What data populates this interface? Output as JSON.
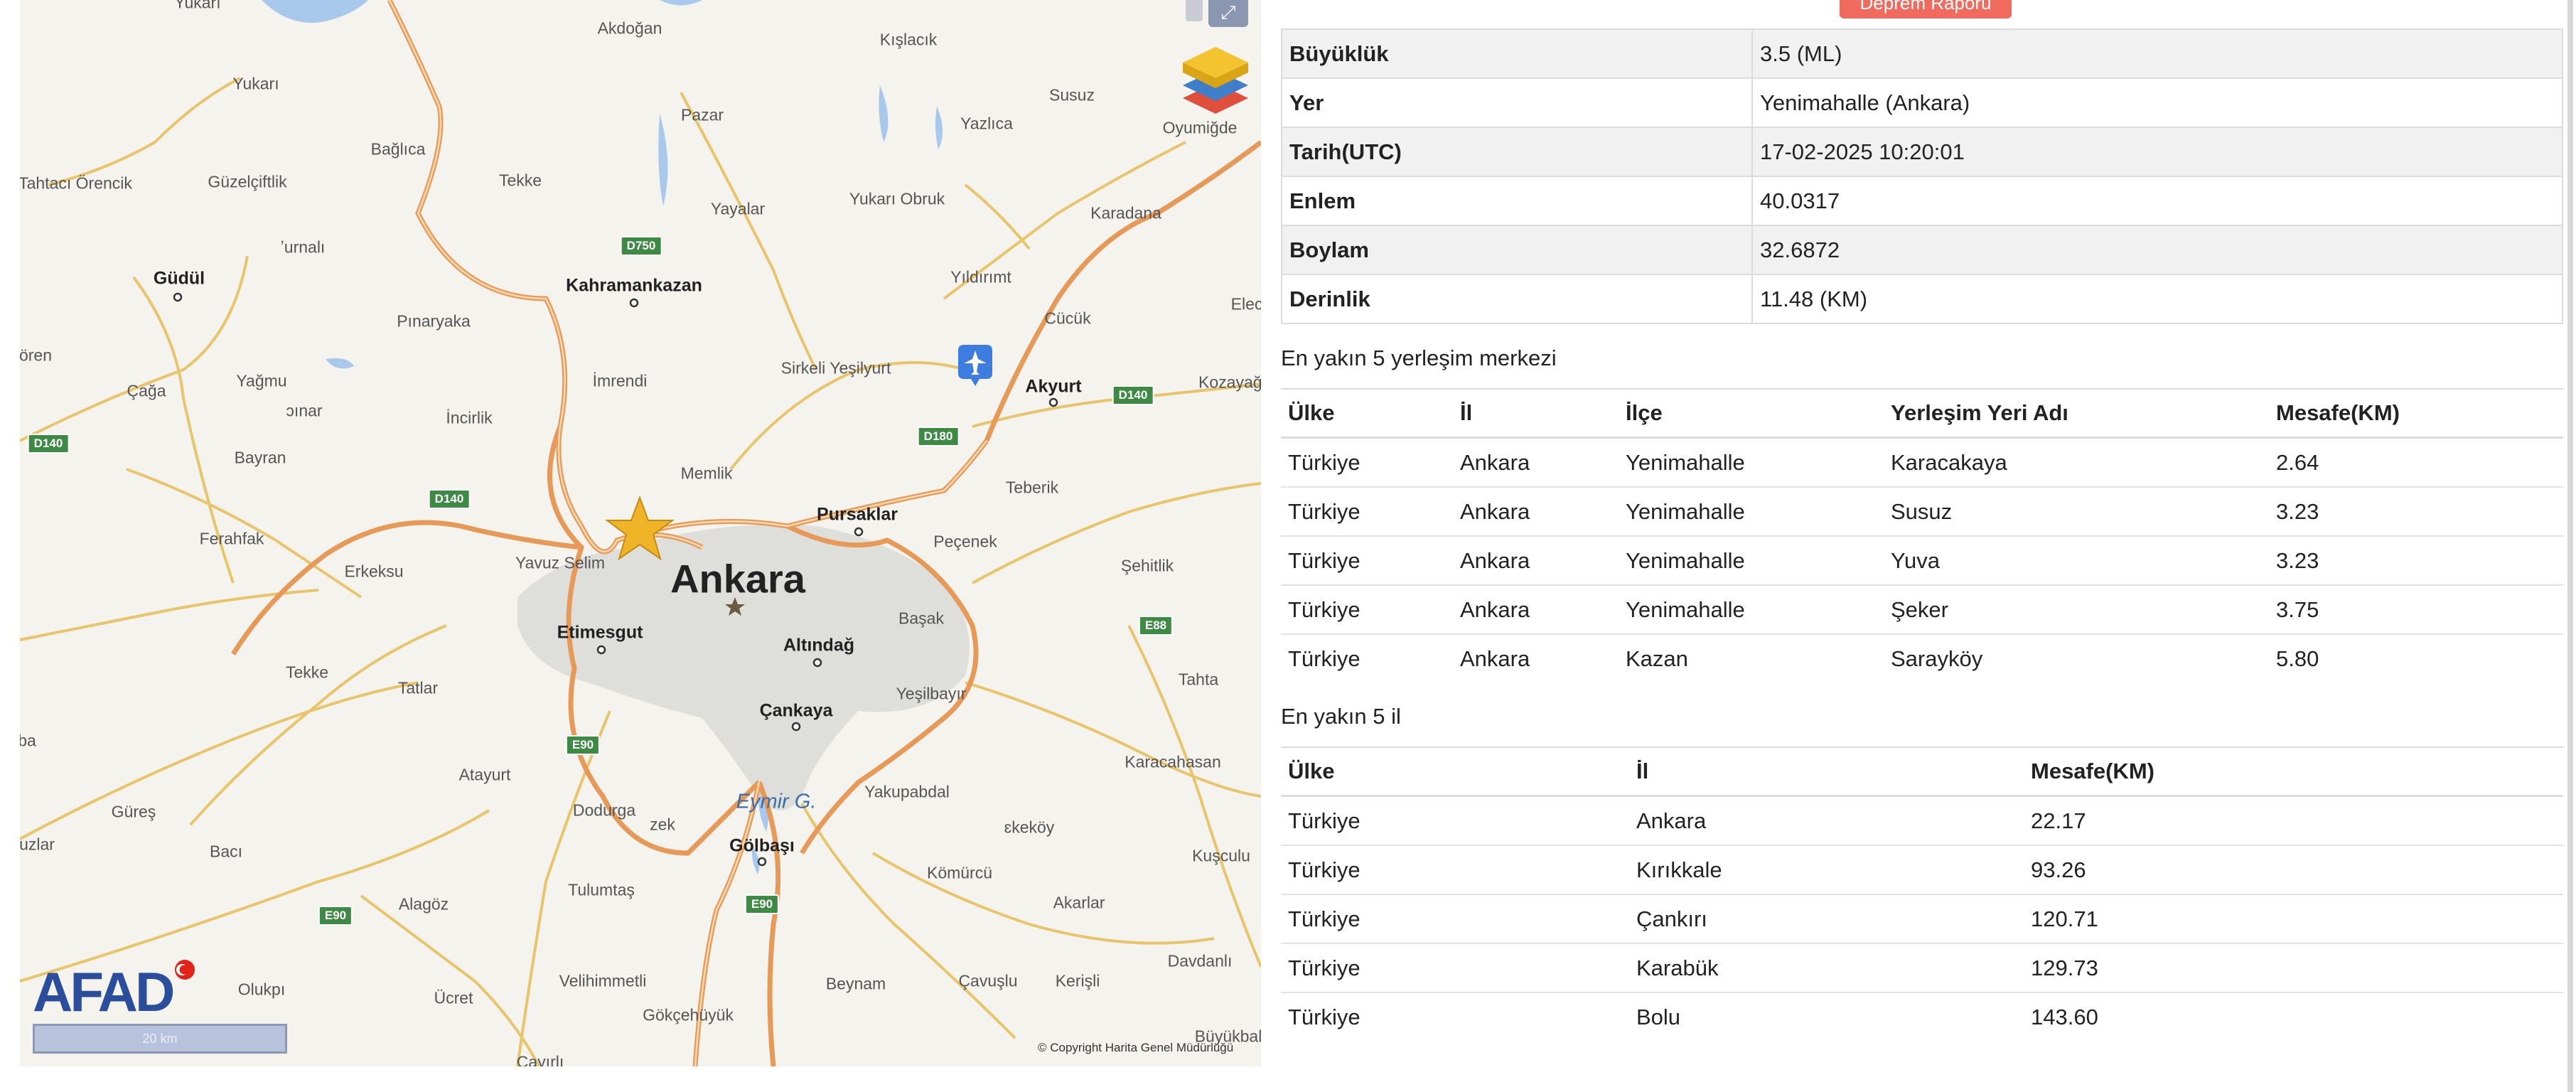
{
  "map": {
    "layers_icon": "layers-icon",
    "expand_icon": "expand-icon",
    "expand_glyph": "⤢",
    "epicenter_icon": "star-icon",
    "airport_icon": "airplane-icon",
    "logo_text": "AFAD",
    "scale_label": "20 km",
    "copyright": "© Copyright Harita Genel Müdürlüğü",
    "places": {
      "yukari": "Yukarı",
      "tahtaci_orencik": "Tahtacı Örencik",
      "guzelciftlik": "Güzelçiftlik",
      "bagilica": "Bağlıca",
      "tekke_n": "Tekke",
      "akdogan": "Akdoğan",
      "pazar": "Pazar",
      "kislacik": "Kışlacık",
      "susuz": "Susuz",
      "yazlica": "Yazlıca",
      "oyumugde": "Oyumiğde",
      "yayalar": "Yayalar",
      "yukari_obruk": "Yukarı Obruk",
      "karadana": "Karadana",
      "gudul": "Güdül",
      "urnali": "ʼurnalı",
      "kahramankazan": "Kahramankazan",
      "yildirimt": "Yıldırımt",
      "cucuk": "Cücük",
      "elec": "Elec",
      "pinaryaka": "Pınaryaka",
      "oren": "ören",
      "caga": "Çağa",
      "yagmu": "Yağmu",
      "imrendi": "İmrendi",
      "sirkeli_yesilyurt": "Sirkeli Yeşilyurt",
      "akyurt": "Akyurt",
      "kozayagi": "Kozayağı",
      "pinar": "ɔınar",
      "incirlik": "İncirlik",
      "bayran": "Bayran",
      "memlik": "Memlik",
      "teberik": "Teberik",
      "ferahfak": "Ferahfak",
      "erkeksu": "Erkeksu",
      "pursaklar": "Pursaklar",
      "pecenek": "Peçenek",
      "sehitlik": "Şehitlik",
      "yavuz_selim": "Yavuz Selim",
      "ankara": "Ankara",
      "etimesgut": "Etimesgut",
      "altindag": "Altındağ",
      "basak": "Başak",
      "tekke_s": "Tekke",
      "tatlar": "Tatlar",
      "yesilbayir": "Yeşilbayır",
      "tahta": "Tahta",
      "cankaya": "Çankaya",
      "ba": "ba",
      "atayurt": "Atayurt",
      "karacahasan": "Karacahasan",
      "eymir": "Eymir G.",
      "yakupabdal": "Yakupabdal",
      "gures": "Güreş",
      "dodurga": "Dodurga",
      "zek": "zek",
      "ekoy": "ɛkeköy",
      "uzlar": "uzlar",
      "baci": "Bacı",
      "golbasi": "Gölbaşı",
      "kusculu": "Kuşculu",
      "tulumtas": "Tulumtaş",
      "komurcu": "Kömürcü",
      "alagoz": "Alagöz",
      "akarlar": "Akarlar",
      "davdanli": "Davdanlı",
      "olukpi": "Olukpı",
      "ucret": "Ücret",
      "velihimmetli": "Velihimmetli",
      "beynam": "Beynam",
      "cavuslu": "Çavuşlu",
      "kerisli": "Kerişli",
      "sokcehuyuk": "Gökçehüyük",
      "buyukbal": "Büyükbal",
      "cayirli": "Çayırlı"
    },
    "shields": {
      "d750": "D750",
      "d140_w": "D140",
      "d140_m": "D140",
      "d140_e": "D140",
      "d180": "D180",
      "e88": "E88",
      "e90_n": "E90",
      "e90_s": "E90",
      "e90_sw": "E90"
    },
    "colors": {
      "road": "#e79a58",
      "minor_road": "#e8c56a",
      "water": "#a8c8ec",
      "urban": "#d8d8d6",
      "land": "#f4f3ee"
    }
  },
  "report_button": "Deprem Raporu",
  "info": [
    {
      "key": "Büyüklük",
      "value": "3.5 (ML)"
    },
    {
      "key": "Yer",
      "value": "Yenimahalle (Ankara)"
    },
    {
      "key": "Tarih(UTC)",
      "value": "17-02-2025 10:20:01"
    },
    {
      "key": "Enlem",
      "value": "40.0317"
    },
    {
      "key": "Boylam",
      "value": "32.6872"
    },
    {
      "key": "Derinlik",
      "value": "11.48 (KM)"
    }
  ],
  "settlements": {
    "title": "En yakın 5 yerleşim merkezi",
    "headers": [
      "Ülke",
      "İl",
      "İlçe",
      "Yerleşim Yeri Adı",
      "Mesafe(KM)"
    ],
    "rows": [
      [
        "Türkiye",
        "Ankara",
        "Yenimahalle",
        "Karacakaya",
        "2.64"
      ],
      [
        "Türkiye",
        "Ankara",
        "Yenimahalle",
        "Susuz",
        "3.23"
      ],
      [
        "Türkiye",
        "Ankara",
        "Yenimahalle",
        "Yuva",
        "3.23"
      ],
      [
        "Türkiye",
        "Ankara",
        "Yenimahalle",
        "Şeker",
        "3.75"
      ],
      [
        "Türkiye",
        "Ankara",
        "Kazan",
        "Sarayköy",
        "5.80"
      ]
    ]
  },
  "provinces": {
    "title": "En yakın 5 il",
    "headers": [
      "Ülke",
      "İl",
      "Mesafe(KM)"
    ],
    "rows": [
      [
        "Türkiye",
        "Ankara",
        "22.17"
      ],
      [
        "Türkiye",
        "Kırıkkale",
        "93.26"
      ],
      [
        "Türkiye",
        "Çankırı",
        "120.71"
      ],
      [
        "Türkiye",
        "Karabük",
        "129.73"
      ],
      [
        "Türkiye",
        "Bolu",
        "143.60"
      ]
    ]
  }
}
